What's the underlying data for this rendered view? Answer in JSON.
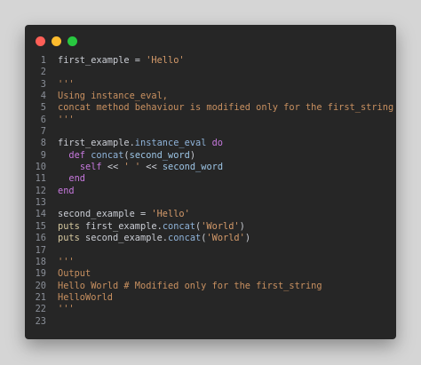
{
  "window": {
    "colors": {
      "background": "#262626",
      "close": "#ff5f57",
      "minimize": "#febc2e",
      "maximize": "#28c840",
      "page": "#d5d5d5"
    },
    "controls": [
      "close-dot",
      "minimize-dot",
      "maximize-dot"
    ]
  },
  "code": {
    "lines": [
      {
        "n": "1",
        "tokens": [
          {
            "t": "first_example = ",
            "c": "default"
          },
          {
            "t": "'Hello'",
            "c": "string"
          }
        ]
      },
      {
        "n": "2",
        "tokens": []
      },
      {
        "n": "3",
        "tokens": [
          {
            "t": "'''",
            "c": "comment"
          }
        ]
      },
      {
        "n": "4",
        "tokens": [
          {
            "t": "Using instance_eval,",
            "c": "comment"
          }
        ]
      },
      {
        "n": "5",
        "tokens": [
          {
            "t": "concat method behaviour is modified only for the first_string",
            "c": "comment"
          }
        ]
      },
      {
        "n": "6",
        "tokens": [
          {
            "t": "'''",
            "c": "comment"
          }
        ]
      },
      {
        "n": "7",
        "tokens": []
      },
      {
        "n": "8",
        "tokens": [
          {
            "t": "first_example.",
            "c": "default"
          },
          {
            "t": "instance_eval",
            "c": "method"
          },
          {
            "t": " do",
            "c": "keyword"
          }
        ]
      },
      {
        "n": "9",
        "tokens": [
          {
            "t": "  ",
            "c": "default"
          },
          {
            "t": "def",
            "c": "keyword"
          },
          {
            "t": " concat",
            "c": "method"
          },
          {
            "t": "(",
            "c": "default"
          },
          {
            "t": "second_word",
            "c": "variable"
          },
          {
            "t": ")",
            "c": "default"
          }
        ]
      },
      {
        "n": "10",
        "tokens": [
          {
            "t": "    ",
            "c": "default"
          },
          {
            "t": "self",
            "c": "keyword"
          },
          {
            "t": " << ",
            "c": "default"
          },
          {
            "t": "' '",
            "c": "string"
          },
          {
            "t": " << ",
            "c": "default"
          },
          {
            "t": "second_word",
            "c": "variable"
          }
        ]
      },
      {
        "n": "11",
        "tokens": [
          {
            "t": "  ",
            "c": "default"
          },
          {
            "t": "end",
            "c": "keyword"
          }
        ]
      },
      {
        "n": "12",
        "tokens": [
          {
            "t": "end",
            "c": "keyword"
          }
        ]
      },
      {
        "n": "13",
        "tokens": []
      },
      {
        "n": "14",
        "tokens": [
          {
            "t": "second_example = ",
            "c": "default"
          },
          {
            "t": "'Hello'",
            "c": "string"
          }
        ]
      },
      {
        "n": "15",
        "tokens": [
          {
            "t": "puts",
            "c": "fn"
          },
          {
            "t": " first_example.",
            "c": "default"
          },
          {
            "t": "concat",
            "c": "method"
          },
          {
            "t": "(",
            "c": "default"
          },
          {
            "t": "'World'",
            "c": "string"
          },
          {
            "t": ")",
            "c": "default"
          }
        ]
      },
      {
        "n": "16",
        "tokens": [
          {
            "t": "puts",
            "c": "fn"
          },
          {
            "t": " second_example.",
            "c": "default"
          },
          {
            "t": "concat",
            "c": "method"
          },
          {
            "t": "(",
            "c": "default"
          },
          {
            "t": "'World'",
            "c": "string"
          },
          {
            "t": ")",
            "c": "default"
          }
        ]
      },
      {
        "n": "17",
        "tokens": []
      },
      {
        "n": "18",
        "tokens": [
          {
            "t": "'''",
            "c": "comment"
          }
        ]
      },
      {
        "n": "19",
        "tokens": [
          {
            "t": "Output",
            "c": "comment"
          }
        ]
      },
      {
        "n": "20",
        "tokens": [
          {
            "t": "Hello World # Modified only for the first_string",
            "c": "comment"
          }
        ]
      },
      {
        "n": "21",
        "tokens": [
          {
            "t": "HelloWorld",
            "c": "comment"
          }
        ]
      },
      {
        "n": "22",
        "tokens": [
          {
            "t": "'''",
            "c": "comment"
          }
        ]
      },
      {
        "n": "23",
        "tokens": []
      }
    ]
  }
}
